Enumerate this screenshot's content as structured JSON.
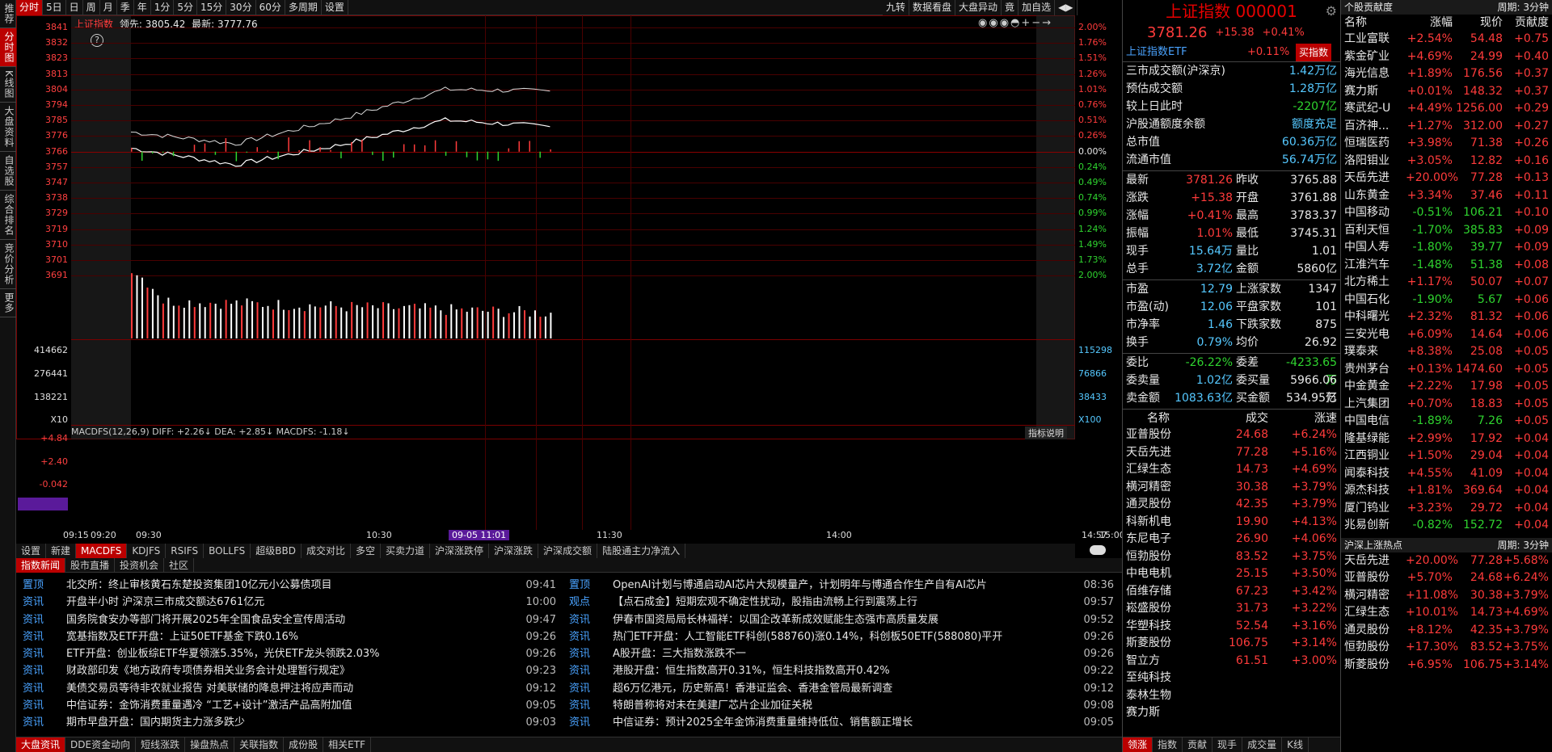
{
  "left_nav": [
    "推荐",
    "分时图",
    "K线图",
    "大盘资料",
    "自选股",
    "综合排名",
    "竞价分析",
    "更多"
  ],
  "toolbar": {
    "tabs": [
      "分时",
      "5日",
      "日",
      "周",
      "月",
      "季",
      "年",
      "1分",
      "5分",
      "15分",
      "30分",
      "60分",
      "多周期",
      "设置"
    ],
    "right": [
      "九转",
      "数据看盘",
      "大盘异动",
      "竟",
      "加自选"
    ]
  },
  "chart": {
    "name": "上证指数",
    "lead": "领先: 3805.42",
    "latest": "最新: 3777.76",
    "help": "?",
    "price_ticks": [
      "3841",
      "3832",
      "3823",
      "3813",
      "3804",
      "3794",
      "3785",
      "3776",
      "3766",
      "3757",
      "3747",
      "3738",
      "3729",
      "3719",
      "3710",
      "3701",
      "3691"
    ],
    "pct_ticks": [
      "2.00%",
      "1.76%",
      "1.51%",
      "1.26%",
      "1.01%",
      "0.76%",
      "0.51%",
      "0.26%",
      "0.00%",
      "0.24%",
      "0.49%",
      "0.74%",
      "0.99%",
      "1.24%",
      "1.49%",
      "1.73%",
      "2.00%"
    ],
    "vol_left": [
      "414662",
      "276441",
      "138221",
      "X10"
    ],
    "vol_right": [
      "115298",
      "76866",
      "38433",
      "X100"
    ],
    "macd_label": "MACDFS(12,26,9) DIFF: +2.26↓ DEA: +2.85↓ MACDFS: -1.18↓",
    "macd_help": "指标说明",
    "macd_ticks": [
      "+4.84",
      "+2.40",
      "-0.042",
      "-2.22"
    ],
    "time_ticks": [
      "09:15",
      "09:20",
      "09:30",
      "10:30",
      "09-05 11:01",
      "11:30",
      "14:00",
      "14:57",
      "15:00"
    ]
  },
  "chart_data": {
    "type": "line",
    "title": "上证指数",
    "x": [
      "09:30",
      "10:00",
      "10:30",
      "11:00",
      "11:30"
    ],
    "series": [
      {
        "name": "上证指数",
        "values": [
          3768,
          3758,
          3770,
          3785,
          3781
        ]
      }
    ],
    "prev_close": 3765.88,
    "ylim": [
      3691,
      3841
    ]
  },
  "indicator_tabs": [
    "设置",
    "新建",
    "MACDFS",
    "KDJFS",
    "RSIFS",
    "BOLLFS",
    "超级BBD",
    "成交对比",
    "多空",
    "买卖力道",
    "沪深涨跌停",
    "沪深涨跌",
    "沪深成交额",
    "陆股通主力净流入"
  ],
  "news_tabs": [
    "指数新闻",
    "股市直播",
    "投资机会",
    "社区"
  ],
  "news_left": [
    {
      "tag": "置顶",
      "title": "北交所：终止审核黄石东楚投资集团10亿元小公募债项目",
      "time": "09:41"
    },
    {
      "tag": "资讯",
      "title": "开盘半小时 沪深京三市成交额达6761亿元",
      "time": "10:00"
    },
    {
      "tag": "资讯",
      "title": "国务院食安办等部门将开展2025年全国食品安全宣传周活动",
      "time": "09:47"
    },
    {
      "tag": "资讯",
      "title": "宽基指数及ETF开盘：上证50ETF基金下跌0.16%",
      "time": "09:26"
    },
    {
      "tag": "资讯",
      "title": "ETF开盘：创业板综ETF华夏领涨5.35%，光伏ETF龙头领跌2.03%",
      "time": "09:26"
    },
    {
      "tag": "资讯",
      "title": "财政部印发《地方政府专项债券相关业务会计处理暂行规定》",
      "time": "09:23"
    },
    {
      "tag": "资讯",
      "title": "美债交易员等待非农就业报告 对美联储的降息押注将应声而动",
      "time": "09:12"
    },
    {
      "tag": "资讯",
      "title": "中信证券：金饰消费重量遇冷 “工艺+设计”激活产品高附加值",
      "time": "09:05"
    },
    {
      "tag": "资讯",
      "title": "期市早盘开盘：国内期货主力涨多跌少",
      "time": "09:03"
    }
  ],
  "news_right": [
    {
      "tag": "置顶",
      "title": "OpenAI计划与博通启动AI芯片大规模量产，计划明年与博通合作生产自有AI芯片",
      "time": "08:36"
    },
    {
      "tag": "观点",
      "title": "【点石成金】短期宏观不确定性扰动，股指由流畅上行到震荡上行",
      "time": "09:57"
    },
    {
      "tag": "资讯",
      "title": "伊春市国资局局长林福祥：以国企改革新成效赋能生态强市高质量发展",
      "time": "09:52"
    },
    {
      "tag": "资讯",
      "title": "热门ETF开盘：人工智能ETF科创(588760)涨0.14%，科创板50ETF(588080)平开",
      "time": "09:26"
    },
    {
      "tag": "资讯",
      "title": "A股开盘：三大指数涨跌不一",
      "time": "09:26"
    },
    {
      "tag": "资讯",
      "title": "港股开盘：恒生指数高开0.31%，恒生科技指数高开0.42%",
      "time": "09:22"
    },
    {
      "tag": "资讯",
      "title": "超6万亿港元，历史新高！香港证监会、香港金管局最新调查",
      "time": "09:12"
    },
    {
      "tag": "资讯",
      "title": "特朗普称将对未在美建厂芯片企业加征关税",
      "time": "09:08"
    },
    {
      "tag": "资讯",
      "title": "中信证券：预计2025全年金饰消费重量维持低位、销售额正增长",
      "time": "09:05"
    }
  ],
  "bottom_tabs": [
    "大盘资讯",
    "DDE资金动向",
    "短线涨跌",
    "操盘热点",
    "关联指数",
    "成份股",
    "相关ETF"
  ],
  "quote": {
    "name": "上证指数 000001",
    "price": "3781.26",
    "chg": "+15.38",
    "pct": "+0.41%",
    "etf_name": "上证指数ETF",
    "etf_pct": "+0.11%",
    "etf_btn": "买指数",
    "stats": [
      [
        "三市成交额(沪深京)",
        "1.42万亿"
      ],
      [
        "预估成交额",
        "1.28万亿"
      ],
      [
        "较上日此时",
        "-2207亿"
      ],
      [
        "沪股通额度余额",
        "额度充足"
      ],
      [
        "总市值",
        "60.36万亿"
      ],
      [
        "流通市值",
        "56.74万亿"
      ]
    ],
    "grid": [
      [
        "最新",
        "3781.26",
        "昨收",
        "3765.88"
      ],
      [
        "涨跌",
        "+15.38",
        "开盘",
        "3761.88"
      ],
      [
        "涨幅",
        "+0.41%",
        "最高",
        "3783.37"
      ],
      [
        "振幅",
        "1.01%",
        "最低",
        "3745.31"
      ],
      [
        "现手",
        "15.64万",
        "量比",
        "1.01"
      ],
      [
        "总手",
        "3.72亿",
        "金额",
        "5860亿"
      ]
    ],
    "grid2": [
      [
        "市盈",
        "12.79",
        "上涨家数",
        "1347"
      ],
      [
        "市盈(动)",
        "12.06",
        "平盘家数",
        "101"
      ],
      [
        "市净率",
        "1.46",
        "下跌家数",
        "875"
      ],
      [
        "换手",
        "0.79%",
        "均价",
        "26.92"
      ]
    ],
    "grid3": [
      [
        "委比",
        "-26.22%",
        "委差",
        "-4233.65万"
      ],
      [
        "委卖量",
        "1.02亿",
        "委买量",
        "5966.06万"
      ],
      [
        "卖金额",
        "1083.63亿",
        "买金额",
        "534.95亿"
      ]
    ]
  },
  "rank_header": [
    "名称",
    "成交",
    "涨速"
  ],
  "rank": [
    [
      "亚普股份",
      "24.68",
      "+6.24%"
    ],
    [
      "天岳先进",
      "77.28",
      "+5.16%"
    ],
    [
      "汇绿生态",
      "14.73",
      "+4.69%"
    ],
    [
      "横河精密",
      "30.38",
      "+3.79%"
    ],
    [
      "通灵股份",
      "42.35",
      "+3.79%"
    ],
    [
      "科新机电",
      "19.90",
      "+4.13%"
    ],
    [
      "东尼电子",
      "26.90",
      "+4.06%"
    ],
    [
      "恒勃股份",
      "83.52",
      "+3.75%"
    ],
    [
      "中电电机",
      "25.15",
      "+3.50%"
    ],
    [
      "佰维存储",
      "67.23",
      "+3.42%"
    ],
    [
      "崧盛股份",
      "31.73",
      "+3.22%"
    ],
    [
      "华塑科技",
      "52.54",
      "+3.16%"
    ],
    [
      "斯菱股份",
      "106.75",
      "+3.14%"
    ],
    [
      "智立方",
      "61.51",
      "+3.00%"
    ],
    [
      "至纯科技",
      "",
      ""
    ],
    [
      "泰林生物",
      "",
      ""
    ],
    [
      "赛力斯",
      "",
      ""
    ]
  ],
  "rank_tabs": [
    "领涨",
    "指数",
    "贡献",
    "现手",
    "成交量",
    "K线"
  ],
  "contrib": {
    "title": "个股贡献度",
    "period": "周期: 3分钟",
    "header": [
      "名称",
      "涨幅",
      "现价",
      "贡献度"
    ],
    "rows": [
      [
        "工业富联",
        "+2.54%",
        "54.48",
        "+0.75"
      ],
      [
        "紫金矿业",
        "+4.69%",
        "24.99",
        "+0.40"
      ],
      [
        "海光信息",
        "+1.89%",
        "176.56",
        "+0.37"
      ],
      [
        "赛力斯",
        "+0.01%",
        "148.32",
        "+0.37"
      ],
      [
        "寒武纪-U",
        "+4.49%",
        "1256.00",
        "+0.29"
      ],
      [
        "百济神...",
        "+1.27%",
        "312.00",
        "+0.27"
      ],
      [
        "恒瑞医药",
        "+3.98%",
        "71.38",
        "+0.26"
      ],
      [
        "洛阳钼业",
        "+3.05%",
        "12.82",
        "+0.16"
      ],
      [
        "天岳先进",
        "+20.00%",
        "77.28",
        "+0.13"
      ],
      [
        "山东黄金",
        "+3.34%",
        "37.46",
        "+0.11"
      ],
      [
        "中国移动",
        "-0.51%",
        "106.21",
        "+0.10"
      ],
      [
        "百利天恒",
        "-1.70%",
        "385.83",
        "+0.09"
      ],
      [
        "中国人寿",
        "-1.80%",
        "39.77",
        "+0.09"
      ],
      [
        "江淮汽车",
        "-1.48%",
        "51.38",
        "+0.08"
      ],
      [
        "北方稀土",
        "+1.17%",
        "50.07",
        "+0.07"
      ],
      [
        "中国石化",
        "-1.90%",
        "5.67",
        "+0.06"
      ],
      [
        "中科曙光",
        "+2.32%",
        "81.32",
        "+0.06"
      ],
      [
        "三安光电",
        "+6.09%",
        "14.64",
        "+0.06"
      ],
      [
        "璞泰来",
        "+8.38%",
        "25.08",
        "+0.05"
      ],
      [
        "贵州茅台",
        "+0.13%",
        "1474.60",
        "+0.05"
      ],
      [
        "中金黄金",
        "+2.22%",
        "17.98",
        "+0.05"
      ],
      [
        "上汽集团",
        "+0.70%",
        "18.83",
        "+0.05"
      ],
      [
        "中国电信",
        "-1.89%",
        "7.26",
        "+0.05"
      ],
      [
        "隆基绿能",
        "+2.99%",
        "17.92",
        "+0.04"
      ],
      [
        "江西铜业",
        "+1.50%",
        "29.04",
        "+0.04"
      ],
      [
        "闻泰科技",
        "+4.55%",
        "41.09",
        "+0.04"
      ],
      [
        "源杰科技",
        "+1.81%",
        "369.64",
        "+0.04"
      ],
      [
        "厦门钨业",
        "+3.23%",
        "29.72",
        "+0.04"
      ],
      [
        "兆易创新",
        "-0.82%",
        "152.72",
        "+0.04"
      ]
    ]
  },
  "hot": {
    "title": "沪深上涨热点",
    "period": "周期: 3分钟",
    "rows": [
      [
        "天岳先进",
        "+20.00%",
        "77.28",
        "+5.68%"
      ],
      [
        "亚普股份",
        "+5.70%",
        "24.68",
        "+6.24%"
      ],
      [
        "横河精密",
        "+11.08%",
        "30.38",
        "+3.79%"
      ],
      [
        "汇绿生态",
        "+10.01%",
        "14.73",
        "+4.69%"
      ],
      [
        "通灵股份",
        "+8.12%",
        "42.35",
        "+3.79%"
      ],
      [
        "恒勃股份",
        "+17.30%",
        "83.52",
        "+3.75%"
      ],
      [
        "斯菱股份",
        "+6.95%",
        "106.75",
        "+3.14%"
      ]
    ]
  }
}
